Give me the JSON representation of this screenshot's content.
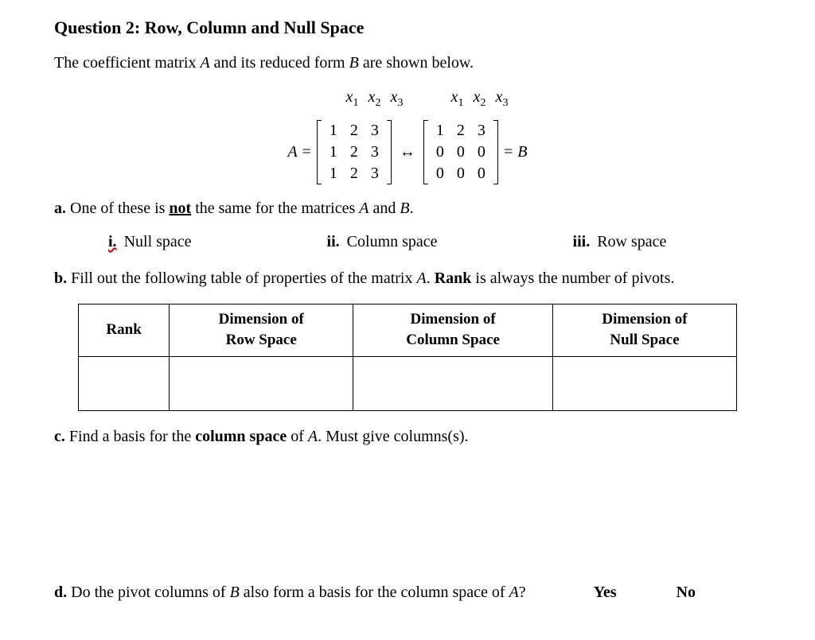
{
  "question": {
    "title": "Question 2: Row, Column and Null Space",
    "intro_pre": "The coefficient matrix ",
    "intro_mid": " and its reduced form ",
    "intro_post": " are shown below.",
    "A": "A",
    "B": "B"
  },
  "matrix": {
    "vars": [
      "x",
      "x",
      "x"
    ],
    "subs": [
      "1",
      "2",
      "3"
    ],
    "lhs": "A =",
    "rhs": "= B",
    "arrow": "↔",
    "A": [
      [
        "1",
        "2",
        "3"
      ],
      [
        "1",
        "2",
        "3"
      ],
      [
        "1",
        "2",
        "3"
      ]
    ],
    "B": [
      [
        "1",
        "2",
        "3"
      ],
      [
        "0",
        "0",
        "0"
      ],
      [
        "0",
        "0",
        "0"
      ]
    ]
  },
  "parts": {
    "a": {
      "lbl": "a.",
      "text_pre": " One of these is ",
      "not": "not",
      "text_post": " the same for the matrices ",
      "and": " and ",
      "period": "."
    },
    "choices": {
      "i_lbl": "i.",
      "i_txt": " Null space",
      "ii_lbl": "ii.",
      "ii_txt": " Column space",
      "iii_lbl": "iii.",
      "iii_txt": " Row space"
    },
    "b": {
      "lbl": "b.",
      "text_pre": " Fill out the following table of properties of the matrix ",
      "text_mid": ". ",
      "rank": "Rank",
      "text_post": " is always the number of pivots."
    },
    "table": {
      "h1": "Rank",
      "h2a": "Dimension of",
      "h2b": "Row Space",
      "h3a": "Dimension of",
      "h3b": "Column Space",
      "h4a": "Dimension of",
      "h4b": "Null Space"
    },
    "c": {
      "lbl": "c.",
      "text_pre": " Find a basis for the ",
      "bold": "column space",
      "text_post": " of ",
      "tail": ". Must give columns(s)."
    },
    "d": {
      "lbl": "d.",
      "text_pre": " Do the pivot columns of ",
      "mid": " also form a basis for the column space of ",
      "q": "?",
      "yes": "Yes",
      "no": "No"
    }
  }
}
